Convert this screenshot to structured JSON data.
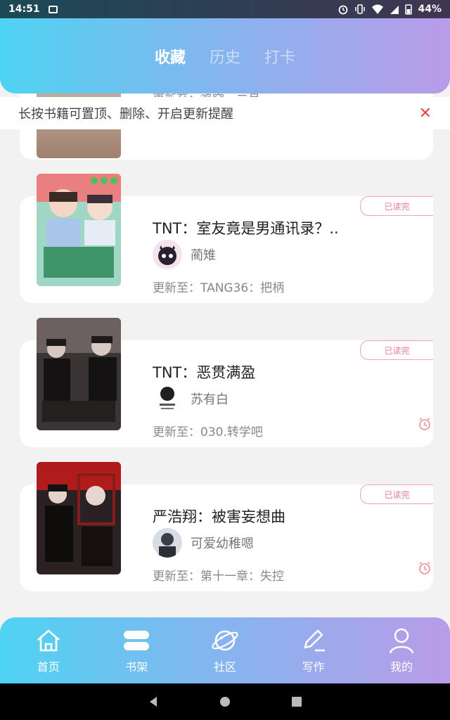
{
  "status_bar": {
    "time": "14:51",
    "battery": "44%"
  },
  "tabs": [
    {
      "label": "收藏"
    },
    {
      "label": "历史"
    },
    {
      "label": "打卡"
    }
  ],
  "notice": {
    "text": "长按书籍可置顶、删除、开启更新提醒",
    "close": "✕"
  },
  "books": [
    {
      "title": "",
      "author": "",
      "update": "更新至：鸡窝一二号",
      "badge": ""
    },
    {
      "title": "TNT：室友竟是男通讯录？..",
      "author": "蔺雉",
      "update": "更新至：TANG36：把柄",
      "badge": "已读完"
    },
    {
      "title": "TNT：恶贯满盈",
      "author": "苏有白",
      "update": "更新至：030.转学吧",
      "badge": "已读完"
    },
    {
      "title": "严浩翔：被害妄想曲",
      "author": "可爱幼稚嗯",
      "update": "更新至：第十一章：失控",
      "badge": "已读完"
    }
  ],
  "bottom_nav": [
    {
      "label": "首页",
      "icon": "home-icon"
    },
    {
      "label": "书架",
      "icon": "bookshelf-icon"
    },
    {
      "label": "社区",
      "icon": "planet-icon"
    },
    {
      "label": "写作",
      "icon": "pen-icon"
    },
    {
      "label": "我的",
      "icon": "user-icon"
    }
  ],
  "colors": {
    "accent_cyan": "#4fd3f2",
    "accent_purple": "#b99be8",
    "badge_pink": "#e8799a",
    "close_red": "#e64a4a"
  }
}
